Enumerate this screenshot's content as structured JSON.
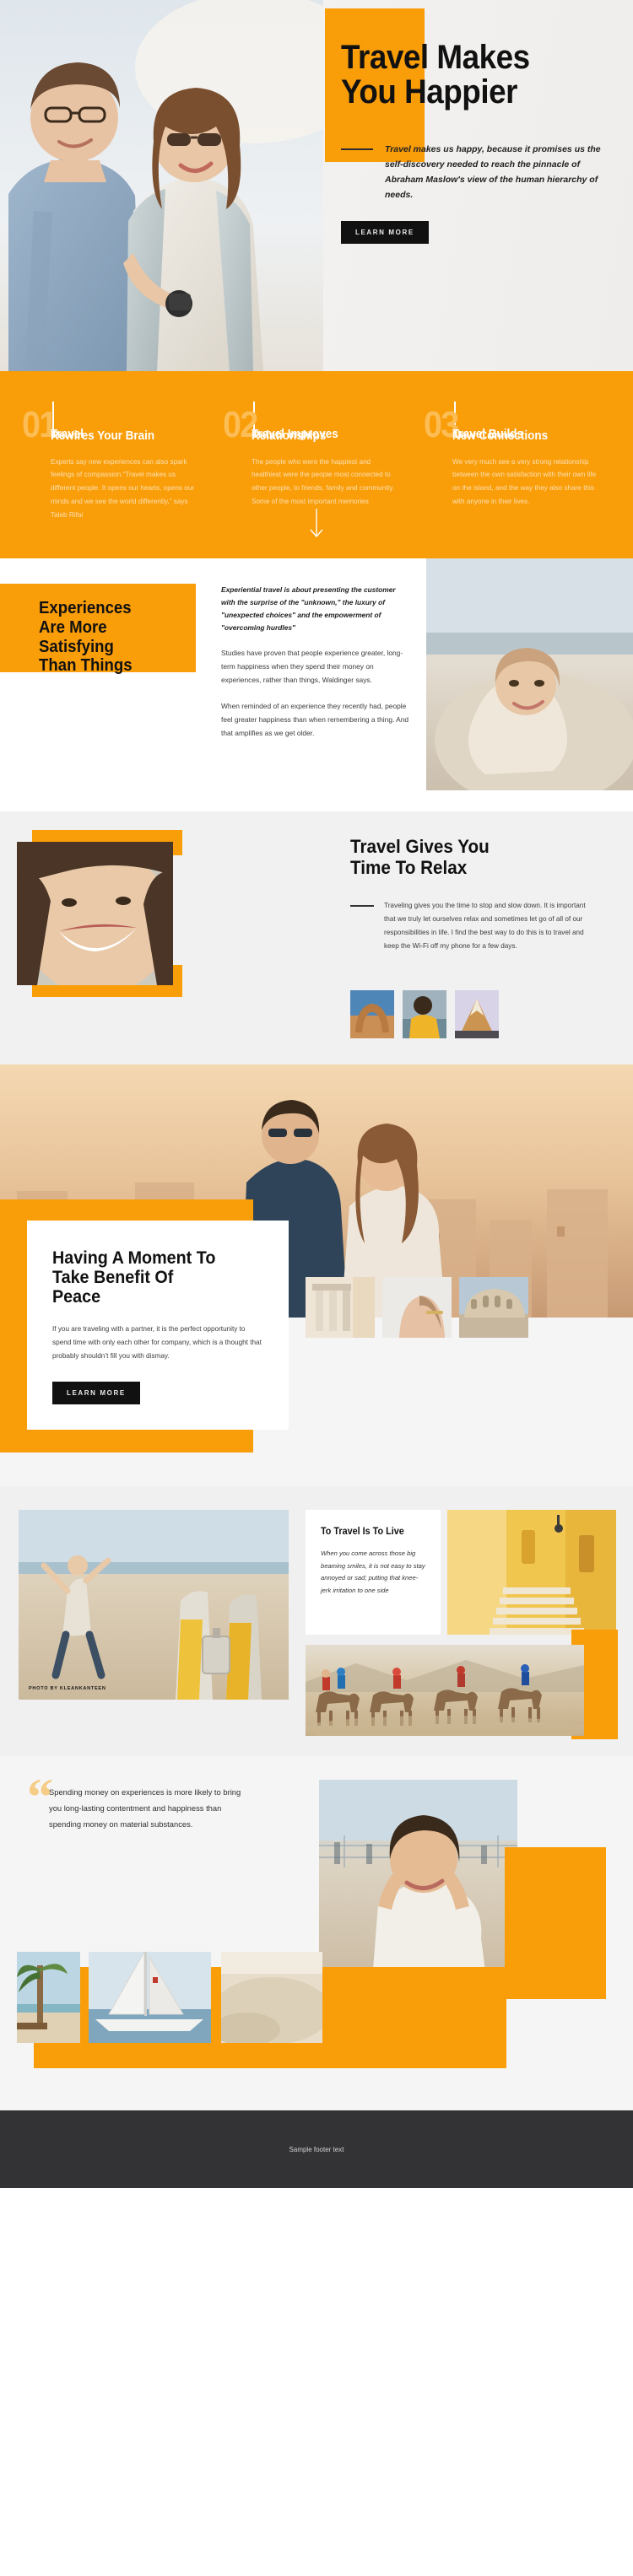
{
  "hero": {
    "title_line1": "Travel Makes",
    "title_line2": "You Happier",
    "subtitle": "Travel makes us happy, because it promises us the self-discovery needed to reach the pinnacle of Abraham Maslow's view of the human hierarchy of needs.",
    "cta": "LEARN MORE",
    "accent_color": "#f99d09"
  },
  "columns": [
    {
      "number": "01",
      "title_line1": "Travel",
      "title_line2": "Rewires Your Brain",
      "body": "Experts say new experiences can also spark feelings of compassion.“Travel makes us different people. It opens our hearts, opens our minds and we see the world differently,” says Taleb Rifai"
    },
    {
      "number": "02",
      "title_line1": "Travel Improves",
      "title_line2": "Relationships",
      "body": "The people who were the happiest and healthiest were the people most connected to other people, to friends, family and community. Some of the most important memories"
    },
    {
      "number": "03",
      "title_line1": "Travel Builds",
      "title_line2": "New Connections",
      "body": "We very much see a very strong relationship between the own satisfaction with their own life on the island, and the way they also share this with anyone in their lives."
    }
  ],
  "experiences": {
    "title_line1": "Experiences",
    "title_line2": "Are More",
    "title_line3": "Satisfying",
    "title_line4": "Than Things",
    "lead": "Experiential travel is about presenting the customer with the surprise of the \"unknown,\" the luxury of \"unexpected choices\" and the empowerment of \"overcoming hurdles\"",
    "para1": "Studies have proven that people experience greater, long-term happiness when they spend their money on experiences, rather than things, Waldinger says.",
    "para2": "When reminded of an experience they recently had, people feel greater happiness than when remembering a thing. And that amplifies as we get older."
  },
  "relax": {
    "title_line1": "Travel Gives You",
    "title_line2": "Time To Relax",
    "body": "Traveling gives you the time to stop and slow down. It is important that we truly let ourselves relax and sometimes let go of all of our responsibilities in life. I find the best way to do this is to travel and keep the Wi-Fi off my phone for a few days.",
    "thumbs": [
      "desert-arch-photo",
      "yellow-jacket-traveler-photo",
      "mountain-peak-photo"
    ]
  },
  "peace": {
    "title_line1": "Having A Moment To",
    "title_line2": "Take Benefit Of",
    "title_line3": "Peace",
    "body": "If you are traveling with a partner, it is the perfect opportunity to spend time with only each other for company, which is a thought that probably shouldn’t fill you with dismay.",
    "cta": "LEARN MORE",
    "thumbs": [
      "roman-columns-photo",
      "woman-hair-photo",
      "colosseum-photo"
    ]
  },
  "live": {
    "title": "To Travel Is To Live",
    "quote": "When you come across those big beaming smiles, it is not easy to stay annoyed or sad; putting that knee-jerk irritation to one side",
    "photo_credit": "PHOTO BY  KLEANKANTEEN"
  },
  "quote_section": {
    "mark": "“",
    "text": "Spending money on experiences is more likely to bring you long-lasting contentment and happiness than spending money on material substances."
  },
  "footer": {
    "text": "Sample footer text"
  }
}
